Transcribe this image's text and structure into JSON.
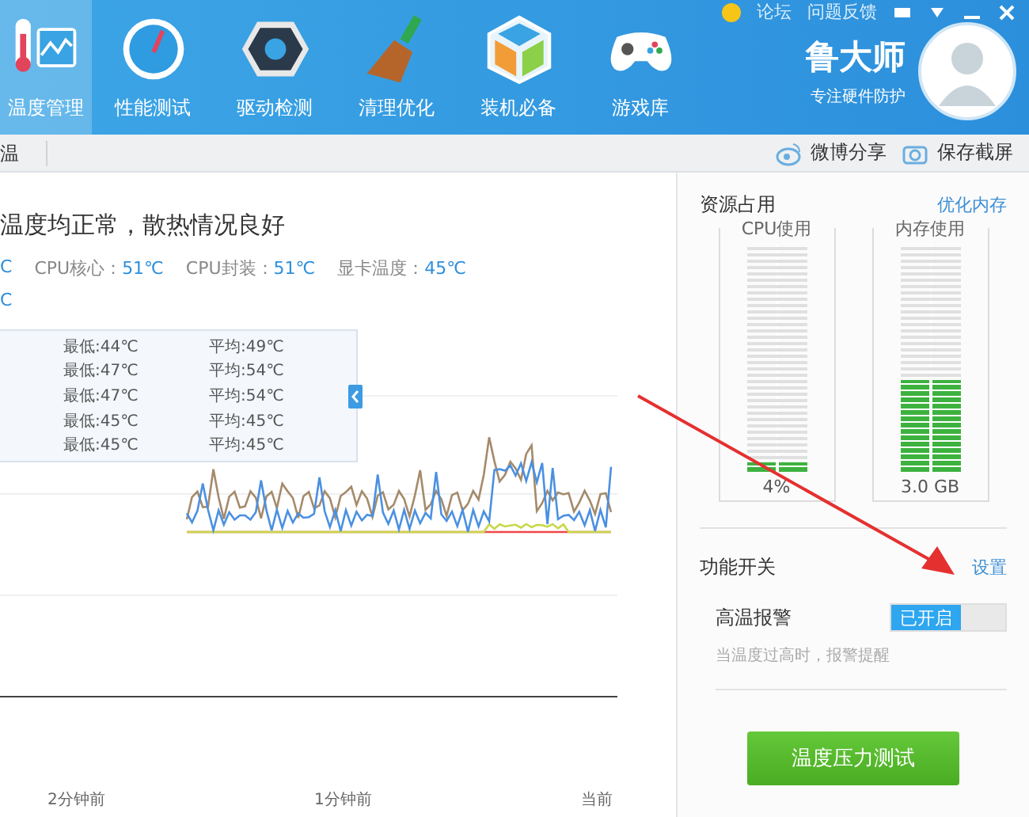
{
  "top_links": [
    "论坛",
    "问题反馈"
  ],
  "tabs": [
    {
      "label": "温度管理",
      "selected": true
    },
    {
      "label": "性能测试",
      "selected": false
    },
    {
      "label": "驱动检测",
      "selected": false
    },
    {
      "label": "清理优化",
      "selected": false
    },
    {
      "label": "装机必备",
      "selected": false
    },
    {
      "label": "游戏库",
      "selected": false
    }
  ],
  "brand": {
    "title": "鲁大师",
    "subtitle": "专注硬件防护"
  },
  "subbar": {
    "tab": "温",
    "actions": [
      "微博分享",
      "保存截屏"
    ]
  },
  "summary": {
    "headline": "温度均正常，散热情况良好",
    "readings": [
      {
        "value": "C"
      },
      {
        "label": "CPU核心：",
        "value": "51℃"
      },
      {
        "label": "CPU封装：",
        "value": "51℃"
      },
      {
        "label": "显卡温度：",
        "value": "45℃"
      }
    ],
    "second_line": "C"
  },
  "legend": [
    {
      "min": "最低:44℃",
      "avg": "平均:49℃"
    },
    {
      "min": "最低:47℃",
      "avg": "平均:54℃"
    },
    {
      "min": "最低:47℃",
      "avg": "平均:54℃"
    },
    {
      "min": "最低:45℃",
      "avg": "平均:45℃"
    },
    {
      "min": "最低:45℃",
      "avg": "平均:45℃"
    }
  ],
  "chart_xlabels": [
    "2分钟前",
    "1分钟前",
    "当前"
  ],
  "resources": {
    "title": "资源占用",
    "link": "优化内存",
    "meters": [
      {
        "label": "CPU使用",
        "level": 0.04,
        "reading": "4%"
      },
      {
        "label": "内存使用",
        "level": 0.4,
        "reading": "3.0 GB"
      }
    ]
  },
  "switches": {
    "title": "功能开关",
    "link": "设置",
    "items": [
      {
        "label": "高温报警",
        "on": true,
        "state_text": "已开启",
        "hint": "当温度过高时，报警提醒"
      }
    ]
  },
  "action_button": "温度压力测试"
}
